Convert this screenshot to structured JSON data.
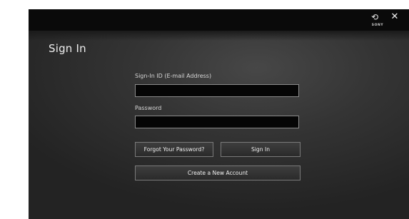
{
  "header": {
    "reload_glyph": "⟲",
    "close_glyph": "✕",
    "brand_text": "SONY"
  },
  "page": {
    "title": "Sign In"
  },
  "form": {
    "signin_id_label": "Sign-In ID (E-mail Address)",
    "signin_id_value": "",
    "password_label": "Password",
    "password_value": ""
  },
  "buttons": {
    "forgot_password": "Forgot Your Password?",
    "sign_in": "Sign In",
    "create_account": "Create a New Account"
  },
  "colors": {
    "background": "#2e2e2e",
    "topbar": "#0a0a0a",
    "field_background": "#050505",
    "field_border": "#8a8a8a",
    "button_border": "#7a7a7a"
  },
  "icons": {
    "reload": "reload-icon",
    "close": "close-icon"
  }
}
